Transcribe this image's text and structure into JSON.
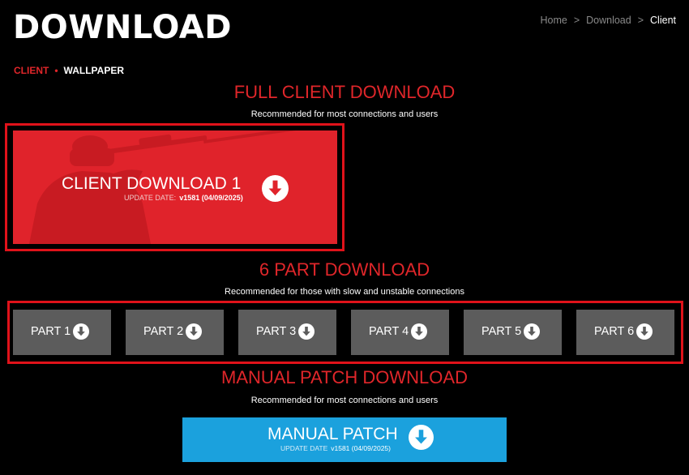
{
  "header": {
    "title": "DOWNLOAD"
  },
  "breadcrumb": {
    "items": [
      "Home",
      "Download",
      "Client"
    ],
    "separator": ">"
  },
  "subnav": {
    "active": "CLIENT",
    "dot": "•",
    "other": "WALLPAPER"
  },
  "full_client": {
    "title": "FULL CLIENT DOWNLOAD",
    "subtitle": "Recommended for most connections and users",
    "button_label": "CLIENT DOWNLOAD 1",
    "date_label": "UPDATE DATE:",
    "date_value": "v1581 (04/09/2025)"
  },
  "six_part": {
    "title": "6 PART DOWNLOAD",
    "subtitle": "Recommended for those with slow and unstable connections",
    "parts": [
      "PART 1",
      "PART 2",
      "PART 3",
      "PART 4",
      "PART 5",
      "PART 6"
    ]
  },
  "manual_patch": {
    "title": "MANUAL PATCH DOWNLOAD",
    "subtitle": "Recommended for most connections and users",
    "button_label": "MANUAL PATCH",
    "date_label": "UPDATE DATE",
    "date_value": "v1581 (04/09/2025)"
  },
  "colors": {
    "accent": "#e0262a",
    "card_red": "#e0232b",
    "part_gray": "#5c5c5c",
    "patch_blue": "#1ba1dd",
    "background": "#000000"
  },
  "icons": {
    "download": "download-arrow-circle-icon"
  }
}
